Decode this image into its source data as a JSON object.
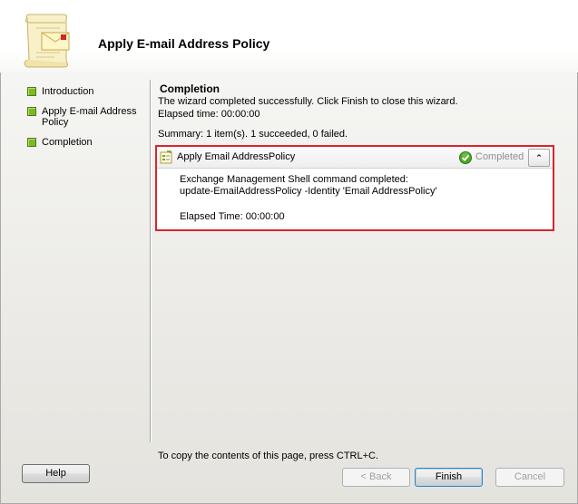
{
  "header": {
    "title": "Apply E-mail Address Policy",
    "icon": "scroll-envelope-icon"
  },
  "nav": {
    "items": [
      {
        "label": "Introduction"
      },
      {
        "label": "Apply E-mail Address Policy"
      },
      {
        "label": "Completion"
      }
    ],
    "bullet_color": "#7eb82a"
  },
  "content": {
    "section_title": "Completion",
    "message": "The wizard completed successfully. Click Finish to close this wizard.",
    "elapsed": "Elapsed time: 00:00:00",
    "summary": "Summary: 1 item(s). 1 succeeded, 0 failed."
  },
  "result": {
    "task_title": "Apply Email AddressPolicy",
    "status": "Completed",
    "status_icon": "green-check-icon",
    "line1": "Exchange Management Shell command completed:",
    "line2": "update-EmailAddressPolicy -Identity 'Email AddressPolicy'",
    "elapsed": "Elapsed Time: 00:00:00",
    "highlight_color": "#d9262c",
    "collapse_glyph": "⌃"
  },
  "footer": {
    "note": "To copy the contents of this page, press CTRL+C.",
    "buttons": {
      "help": "Help",
      "back": "< Back",
      "finish": "Finish",
      "cancel": "Cancel"
    }
  }
}
